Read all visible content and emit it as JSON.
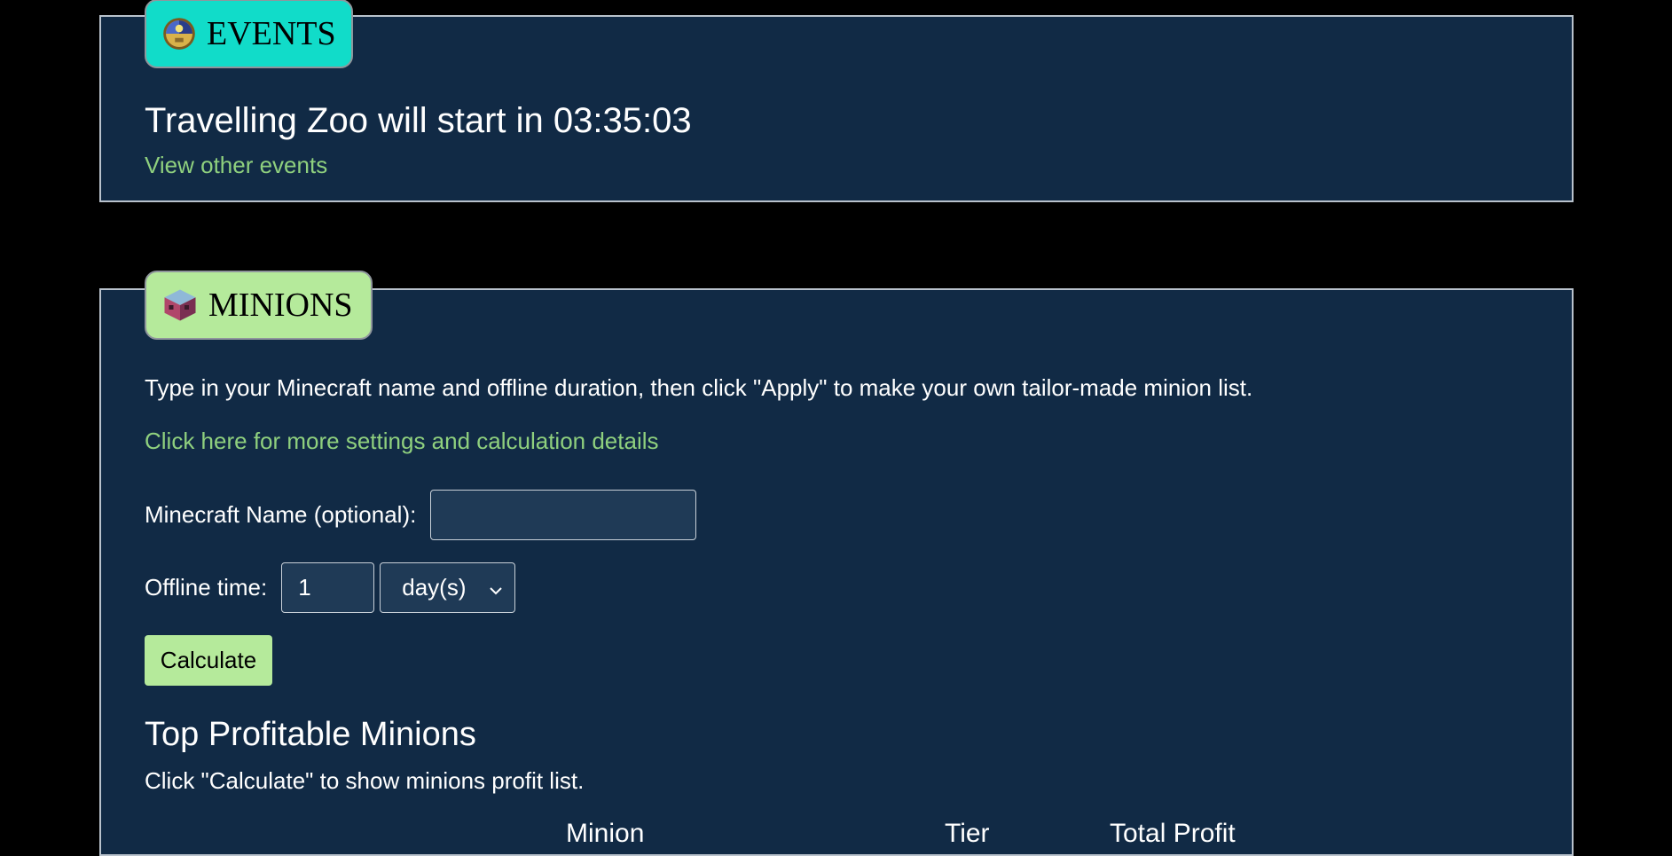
{
  "events": {
    "tab_label": "EVENTS",
    "tab_icon": "clock-icon",
    "headline": "Travelling Zoo will start in 03:35:03",
    "link": "View other events"
  },
  "minions": {
    "tab_label": "MINIONS",
    "tab_icon": "minion-block-icon",
    "intro": "Type in your Minecraft name and offline duration, then click \"Apply\" to make your own tailor-made minion list.",
    "settings_link": "Click here for more settings and calculation details",
    "name_label": "Minecraft Name (optional):",
    "name_value": "",
    "offline_label": "Offline time:",
    "offline_value": "1",
    "offline_unit": "day(s)",
    "calculate_label": "Calculate",
    "section_title": "Top Profitable Minions",
    "section_sub": "Click \"Calculate\" to show minions profit list.",
    "columns": [
      "Minion",
      "Tier",
      "Total Profit"
    ]
  },
  "colors": {
    "background": "#000000",
    "panel": "#112a45",
    "events_tab": "#11dcc9",
    "minions_tab": "#b5ea9b",
    "link": "#8fd07e",
    "button": "#b5ea9b"
  }
}
